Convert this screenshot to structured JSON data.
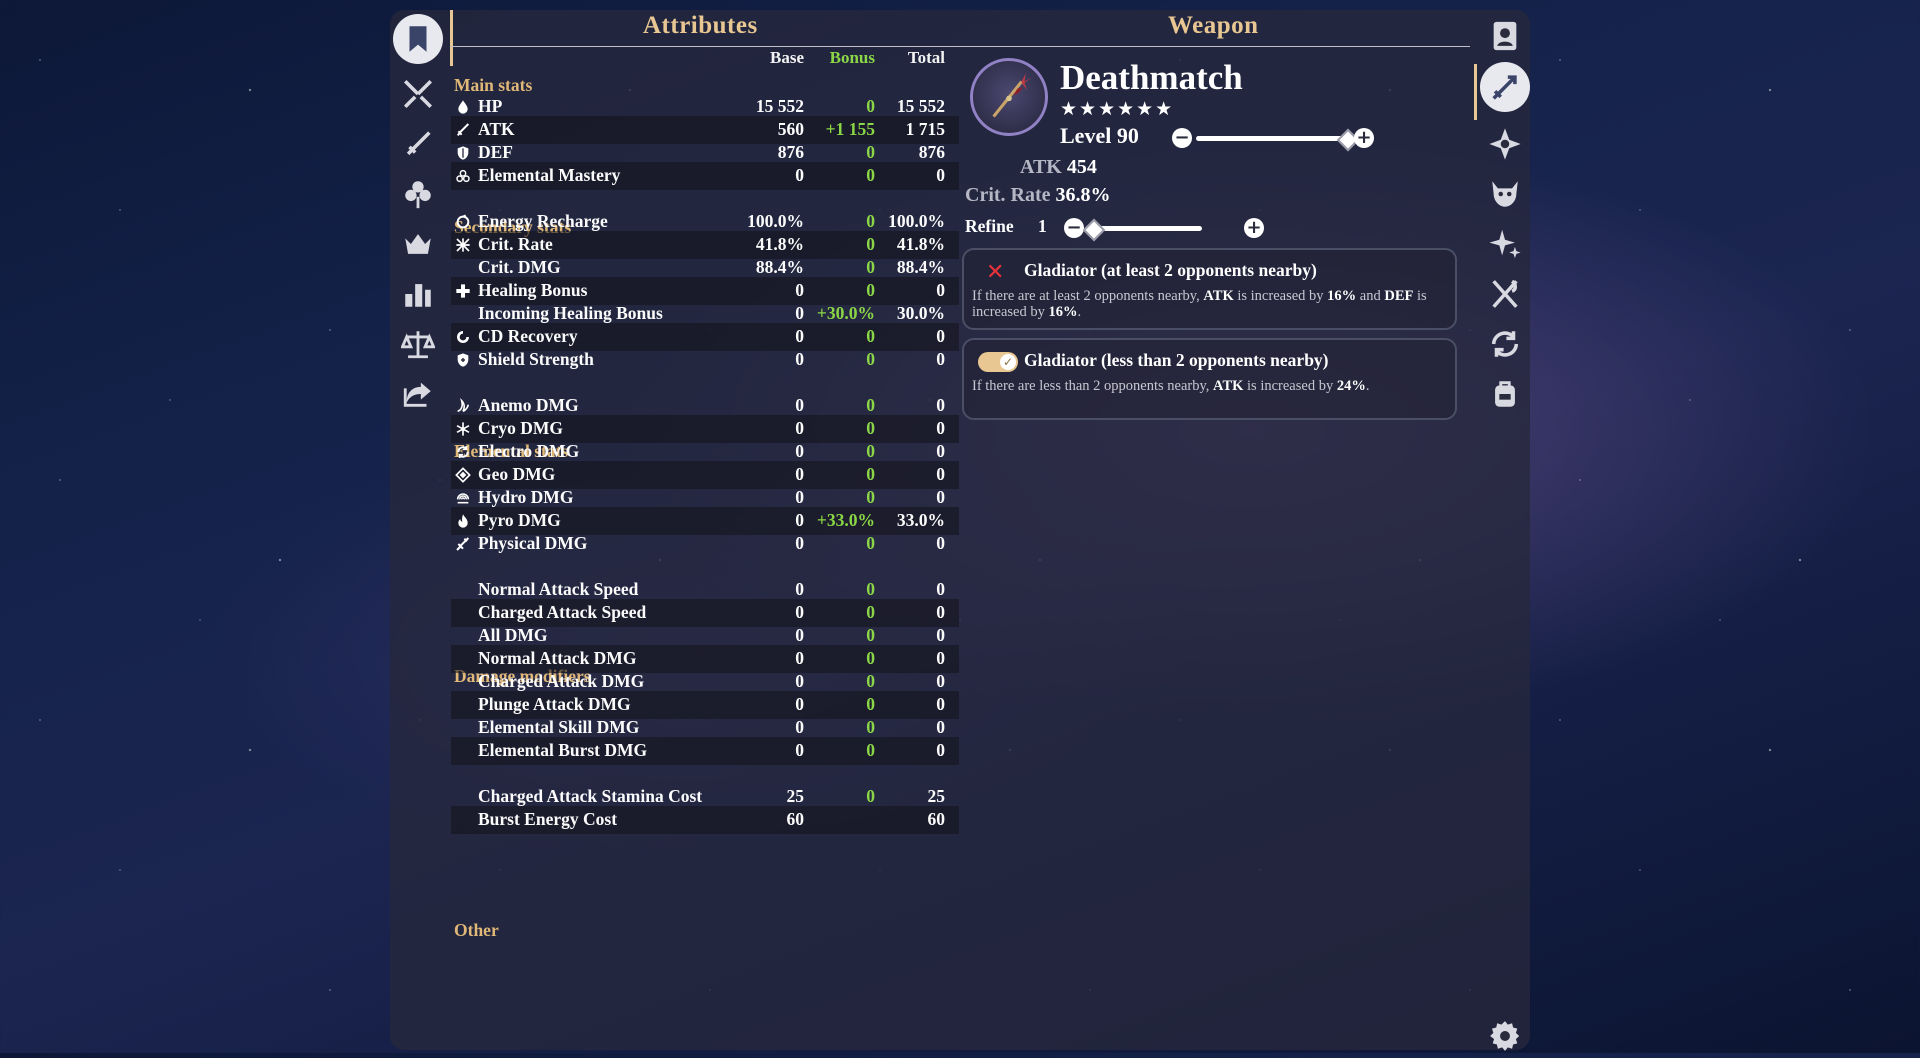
{
  "colors": {
    "accent": "#e8c792",
    "bonus": "#8ad646",
    "category": "#e0b878",
    "warning": "#e8323a"
  },
  "left_nav": [
    {
      "icon": "bookmark-icon",
      "active": true
    },
    {
      "icon": "crossed-swords-icon"
    },
    {
      "icon": "sword-icon"
    },
    {
      "icon": "flower-artifact-icon"
    },
    {
      "icon": "crown-icon"
    },
    {
      "icon": "bar-chart-icon"
    },
    {
      "icon": "balance-scale-icon"
    },
    {
      "icon": "share-icon"
    }
  ],
  "right_nav": [
    {
      "icon": "character-card-icon"
    },
    {
      "icon": "weapon-icon",
      "active": true
    },
    {
      "icon": "element-star-icon"
    },
    {
      "icon": "monster-mask-icon"
    },
    {
      "icon": "sparkle-icon"
    },
    {
      "icon": "fork-knife-icon"
    },
    {
      "icon": "refresh-icon"
    },
    {
      "icon": "backpack-icon"
    },
    {
      "icon": "gear-icon"
    }
  ],
  "attributes": {
    "title": "Attributes",
    "columns": {
      "base": "Base",
      "bonus": "Bonus",
      "total": "Total"
    },
    "categories": {
      "main": "Main stats",
      "secondary": "Secondary stats",
      "elemental": "Elemental stats",
      "damage": "Damage modifiers",
      "other": "Other"
    },
    "rows": [
      {
        "icon": "hp-drop-icon",
        "name": "HP",
        "base": "15 552",
        "bonus": "0",
        "total": "15 552"
      },
      {
        "icon": "atk-sword-icon",
        "name": "ATK",
        "base": "560",
        "bonus": "+1 155",
        "total": "1 715"
      },
      {
        "icon": "def-shield-icon",
        "name": "DEF",
        "base": "876",
        "bonus": "0",
        "total": "876"
      },
      {
        "icon": "elemental-mastery-icon",
        "name": "Elemental Mastery",
        "base": "0",
        "bonus": "0",
        "total": "0"
      },
      {
        "icon": "energy-recharge-icon",
        "name": "Energy Recharge",
        "base": "100.0%",
        "bonus": "0",
        "total": "100.0%"
      },
      {
        "icon": "crit-rate-icon",
        "name": "Crit. Rate",
        "base": "41.8%",
        "bonus": "0",
        "total": "41.8%"
      },
      {
        "icon": "",
        "name": "Crit. DMG",
        "base": "88.4%",
        "bonus": "0",
        "total": "88.4%"
      },
      {
        "icon": "healing-plus-icon",
        "name": "Healing Bonus",
        "base": "0",
        "bonus": "0",
        "total": "0"
      },
      {
        "icon": "",
        "name": "Incoming Healing Bonus",
        "base": "0",
        "bonus": "+30.0%",
        "total": "30.0%"
      },
      {
        "icon": "cd-recovery-icon",
        "name": "CD Recovery",
        "base": "0",
        "bonus": "0",
        "total": "0"
      },
      {
        "icon": "shield-strength-icon",
        "name": "Shield Strength",
        "base": "0",
        "bonus": "0",
        "total": "0"
      },
      {
        "icon": "anemo-icon",
        "name": "Anemo DMG",
        "base": "0",
        "bonus": "0",
        "total": "0"
      },
      {
        "icon": "cryo-icon",
        "name": "Cryo DMG",
        "base": "0",
        "bonus": "0",
        "total": "0"
      },
      {
        "icon": "electro-icon",
        "name": "Electro DMG",
        "base": "0",
        "bonus": "0",
        "total": "0"
      },
      {
        "icon": "geo-icon",
        "name": "Geo DMG",
        "base": "0",
        "bonus": "0",
        "total": "0"
      },
      {
        "icon": "hydro-icon",
        "name": "Hydro DMG",
        "base": "0",
        "bonus": "0",
        "total": "0"
      },
      {
        "icon": "pyro-icon",
        "name": "Pyro DMG",
        "base": "0",
        "bonus": "+33.0%",
        "total": "33.0%"
      },
      {
        "icon": "physical-icon",
        "name": "Physical DMG",
        "base": "0",
        "bonus": "0",
        "total": "0"
      },
      {
        "icon": "",
        "name": "Normal Attack Speed",
        "base": "0",
        "bonus": "0",
        "total": "0"
      },
      {
        "icon": "",
        "name": "Charged Attack Speed",
        "base": "0",
        "bonus": "0",
        "total": "0"
      },
      {
        "icon": "",
        "name": "All DMG",
        "base": "0",
        "bonus": "0",
        "total": "0"
      },
      {
        "icon": "",
        "name": "Normal Attack DMG",
        "base": "0",
        "bonus": "0",
        "total": "0"
      },
      {
        "icon": "",
        "name": "Charged Attack DMG",
        "base": "0",
        "bonus": "0",
        "total": "0"
      },
      {
        "icon": "",
        "name": "Plunge Attack DMG",
        "base": "0",
        "bonus": "0",
        "total": "0"
      },
      {
        "icon": "",
        "name": "Elemental Skill DMG",
        "base": "0",
        "bonus": "0",
        "total": "0"
      },
      {
        "icon": "",
        "name": "Elemental Burst DMG",
        "base": "0",
        "bonus": "0",
        "total": "0"
      },
      {
        "icon": "",
        "name": "Charged Attack Stamina Cost",
        "base": "25",
        "bonus": "0",
        "total": "25"
      },
      {
        "icon": "",
        "name": "Burst Energy Cost",
        "base": "60",
        "bonus": "",
        "total": "60"
      }
    ]
  },
  "weapon": {
    "title": "Weapon",
    "icon": "polearm-weapon-icon",
    "name": "Deathmatch",
    "stars": "★★★★★★",
    "level_label": "Level 90",
    "level_fraction": 1.0,
    "atk_label": "ATK",
    "atk_value": "454",
    "sub_label": "Crit. Rate",
    "sub_value": "36.8%",
    "refine_label": "Refine",
    "refine_value": "1",
    "refine_fraction": 0.0,
    "passives": [
      {
        "state": "off",
        "title": "Gladiator (at least 2 opponents nearby)",
        "desc_1": "If there are at least 2 opponents nearby, ",
        "desc_b1": "ATK",
        "desc_2": " is increased by ",
        "desc_b2": "16%",
        "desc_3": " and ",
        "desc_b3": "DEF",
        "desc_4": " is increased by ",
        "desc_b4": "16%",
        "desc_5": "."
      },
      {
        "state": "on",
        "title": "Gladiator (less than 2 opponents nearby)",
        "desc_1": "If there are less than 2 opponents nearby, ",
        "desc_b1": "ATK",
        "desc_2": " is increased by ",
        "desc_b2": "24%",
        "desc_3": "."
      }
    ]
  }
}
